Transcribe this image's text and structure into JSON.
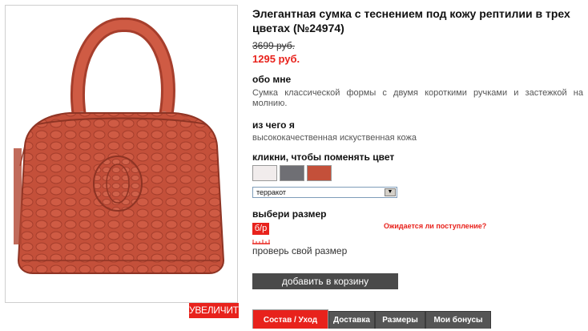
{
  "product": {
    "title": "Элегантная сумка с теснением под кожу рептилии в трех цветах (№24974)",
    "old_price": "3699 руб.",
    "new_price": "1295 руб."
  },
  "gallery": {
    "zoom_label": "УВЕЛИЧИТЬ"
  },
  "about": {
    "heading": "обо мне",
    "text": "Сумка классической формы с двумя короткими ручками и застежкой на молнию."
  },
  "material": {
    "heading": "из чего я",
    "text": "высококачественная искуственная кожа"
  },
  "colors": {
    "heading": "кликни, чтобы поменять цвет",
    "swatches": [
      {
        "name": "white",
        "color": "#f1ecec"
      },
      {
        "name": "grey",
        "color": "#6f6f74"
      },
      {
        "name": "terracotta",
        "color": "#c4503a"
      }
    ],
    "selected": "терракот"
  },
  "size": {
    "heading": "выбери размер",
    "badge": "б/р",
    "expect_link": "Ожидается ли поступление?",
    "check_link": "проверь свой размер"
  },
  "cart": {
    "button_label": "добавить в корзину"
  },
  "tabs": [
    {
      "label": "Состав / Уход",
      "active": true
    },
    {
      "label": "Доставка",
      "active": false
    },
    {
      "label": "Размеры",
      "active": false
    },
    {
      "label": "Мои бонусы",
      "active": false
    }
  ],
  "colors_ui": {
    "accent": "#e8221c",
    "dark_button": "#4a4a4a",
    "bag": "#c4503a"
  }
}
